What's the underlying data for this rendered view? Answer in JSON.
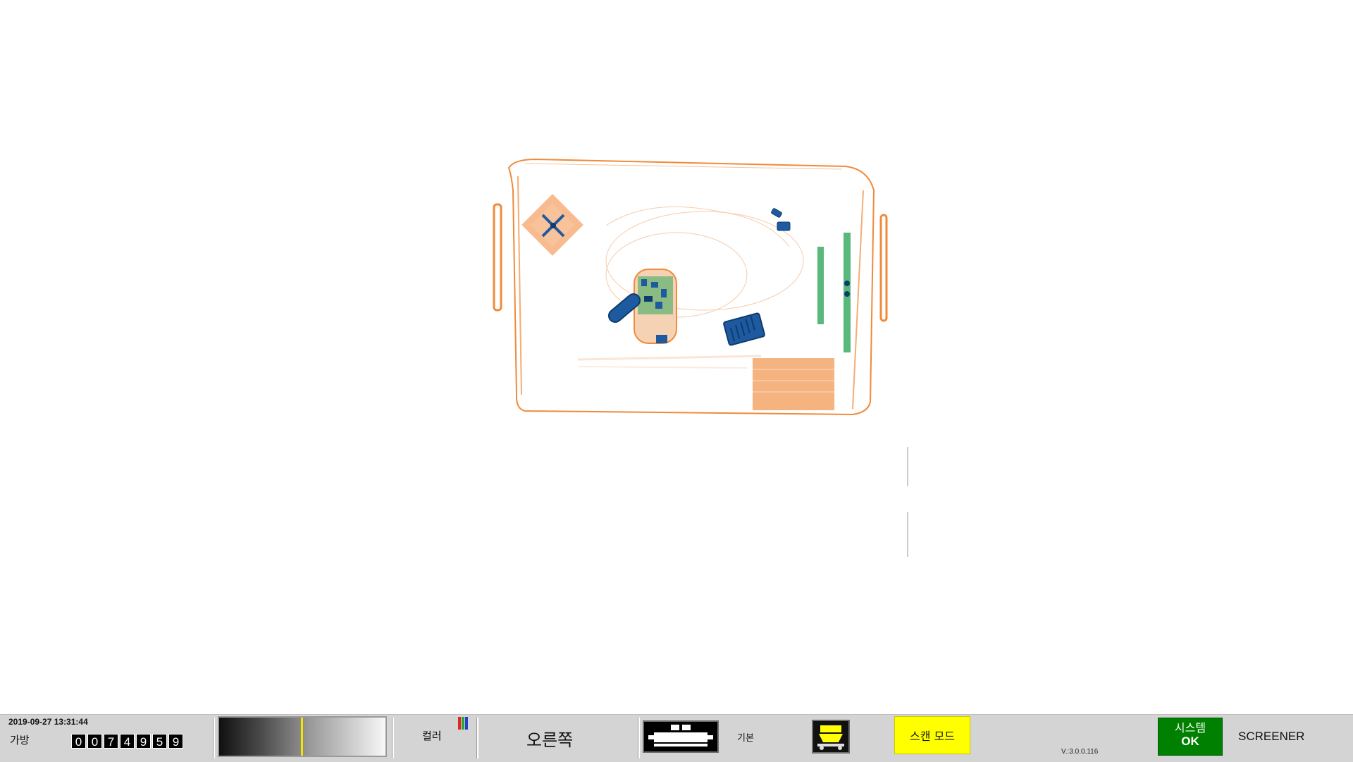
{
  "viewport": {
    "image_description_icon": "xray-baggage-scan"
  },
  "status": {
    "datetime": "2019-09-27 13:31:44",
    "bag_label": "가방",
    "bag_counter": [
      "0",
      "0",
      "7",
      "4",
      "9",
      "5",
      "9"
    ],
    "gray_level_fraction": 0.49,
    "color_label": "컬러",
    "color_icon_colors": [
      "#e0261f",
      "#2aa53a",
      "#2340c8"
    ],
    "direction": "오른쪽",
    "basic_label": "기본",
    "scan_mode": "스캔 모드",
    "version": "V.:3.0.0.116",
    "system_line1": "시스템",
    "system_line2": "OK",
    "operator_role": "SCREENER"
  },
  "colors": {
    "statusbar": "#d4d4d4",
    "scan_mode_bg": "#ffff00",
    "system_ok_bg": "#008000",
    "organic": "#f08a3a",
    "metal": "#1e5aa0",
    "mixed": "#2fa85a"
  }
}
